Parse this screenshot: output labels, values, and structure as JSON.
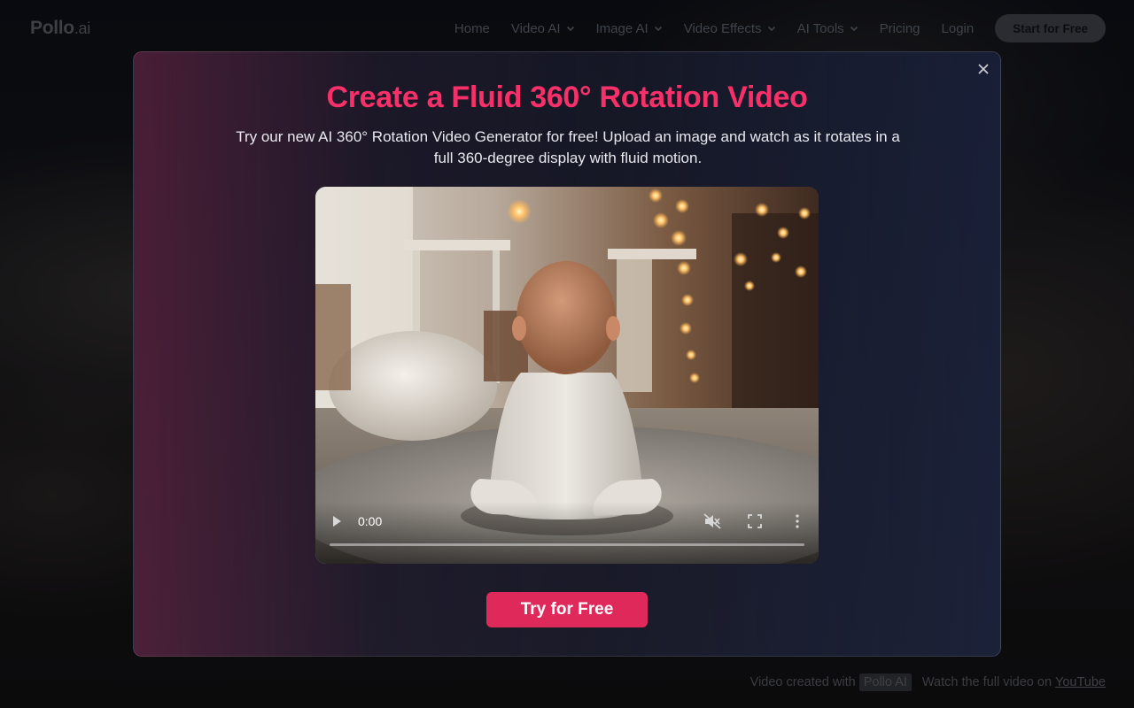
{
  "header": {
    "logo_main": "Pollo",
    "logo_suffix": ".ai",
    "nav": [
      {
        "label": "Home",
        "dropdown": false
      },
      {
        "label": "Video AI",
        "dropdown": true
      },
      {
        "label": "Image AI",
        "dropdown": true
      },
      {
        "label": "Video Effects",
        "dropdown": true
      },
      {
        "label": "AI Tools",
        "dropdown": true
      },
      {
        "label": "Pricing",
        "dropdown": false
      },
      {
        "label": "Login",
        "dropdown": false
      }
    ],
    "start_button": "Start for Free"
  },
  "modal": {
    "title": "Create a Fluid 360° Rotation Video",
    "description": "Try our new AI 360° Rotation Video Generator for free! Upload an image and watch as it rotates in a full 360-degree display with fluid motion.",
    "close_icon": "close-icon",
    "video": {
      "current_time": "0:00",
      "progress": 0,
      "muted": true,
      "icons": [
        "play-icon",
        "muted-speaker-icon",
        "fullscreen-icon",
        "more-vertical-icon"
      ]
    },
    "cta_label": "Try for Free"
  },
  "footer": {
    "prefix": "Video created with",
    "brand": "Pollo AI",
    "watch_text": "Watch the full video on",
    "link_text": "YouTube"
  },
  "colors": {
    "title_pink": "#f7306a",
    "cta_pink": "#e0295b"
  }
}
